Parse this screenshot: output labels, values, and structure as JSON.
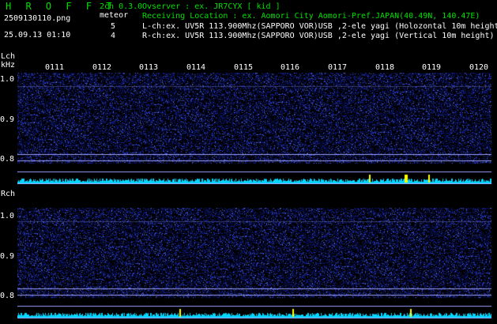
{
  "header": {
    "app_title": "H R O F F T",
    "version": "2ch 0.3.0",
    "filename": "2509130110.png",
    "datetime": "25.09.13 01:10",
    "meteor_label": "meteor",
    "lch_count": "5",
    "rch_count": "4",
    "observer": "Ovserver           : ex. JR7CYX [ kid ]",
    "location": "Receiving Location : ex. Aomori City Aomori-Pref.JAPAN(40.49N, 140.47E)",
    "lch_desc": "L-ch:ex. UV5R 113.900Mhz(SAPPORO VOR)USB ,2-ele yagi (Holozontal 10m height",
    "rch_desc": "R-ch:ex. UV5R 113.900Mhz(SAPPORO VOR)USB ,2-ele yagi (Vertical 10m height)"
  },
  "lch": {
    "label": "Lch",
    "unit": "kHz",
    "yticks": [
      "1.0",
      "0.9",
      "0.8"
    ]
  },
  "rch": {
    "label": "Rch",
    "yticks": [
      "1.0",
      "0.9",
      "0.8"
    ]
  },
  "time_labels": [
    "0111",
    "0112",
    "0113",
    "0114",
    "0115",
    "0116",
    "0117",
    "0118",
    "0119",
    "0120"
  ],
  "colors": {
    "background": "#000000",
    "noise": "#1a2aa8",
    "level_bar": "#00d8ff",
    "meteor_hit": "#ffff00",
    "header_green": "#00e000"
  }
}
